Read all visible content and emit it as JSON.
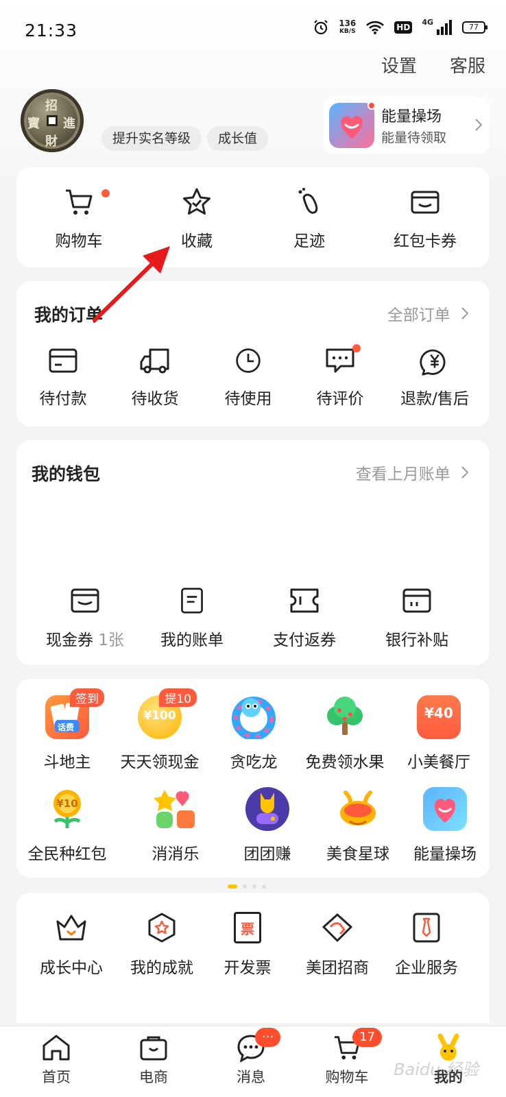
{
  "status_bar": {
    "time": "21:33",
    "net_speed": "136",
    "net_unit": "KB/S",
    "hd": "HD",
    "network": "4G",
    "battery": "77"
  },
  "top_links": {
    "settings": "设置",
    "service": "客服"
  },
  "profile": {
    "avatar_chars": [
      "招",
      "進",
      "財",
      "寶"
    ],
    "pill_realname": "提升实名等级",
    "pill_growth": "成长值"
  },
  "energy_card": {
    "title": "能量操场",
    "subtitle": "能量待领取"
  },
  "quick": [
    {
      "label": "购物车",
      "icon": "cart-icon"
    },
    {
      "label": "收藏",
      "icon": "star-icon"
    },
    {
      "label": "足迹",
      "icon": "footprint-icon"
    },
    {
      "label": "红包卡券",
      "icon": "wallet-card-icon"
    }
  ],
  "orders": {
    "title": "我的订单",
    "all_link": "全部订单",
    "items": [
      {
        "label": "待付款",
        "icon": "card-icon"
      },
      {
        "label": "待收货",
        "icon": "truck-icon"
      },
      {
        "label": "待使用",
        "icon": "clock-icon"
      },
      {
        "label": "待评价",
        "icon": "comment-icon"
      },
      {
        "label": "退款/售后",
        "icon": "yen-refund-icon"
      }
    ]
  },
  "wallet": {
    "title": "我的钱包",
    "link": "查看上月账单",
    "items": [
      {
        "label": "现金券",
        "sub": "1张",
        "icon": "coupon-wallet-icon"
      },
      {
        "label": "我的账单",
        "icon": "bill-icon"
      },
      {
        "label": "支付返券",
        "icon": "ticket-icon"
      },
      {
        "label": "银行补贴",
        "icon": "bank-card-icon"
      }
    ]
  },
  "games": {
    "row1": [
      {
        "label": "斗地主",
        "badge": "签到",
        "icon": "doudizhu-icon",
        "icon_text": "话费"
      },
      {
        "label": "天天领现金",
        "badge": "提10",
        "icon": "cash-coin-icon",
        "icon_text": "¥100"
      },
      {
        "label": "贪吃龙",
        "icon": "snake-icon"
      },
      {
        "label": "免费领水果",
        "icon": "fruit-tree-icon"
      },
      {
        "label": "小美餐厅",
        "icon": "restaurant-icon",
        "icon_text": "¥40"
      }
    ],
    "row2": [
      {
        "label": "全民种红包",
        "icon": "flower-icon",
        "icon_text": "¥10"
      },
      {
        "label": "消消乐",
        "icon": "match-icon"
      },
      {
        "label": "团团赚",
        "icon": "tuantuan-icon"
      },
      {
        "label": "美食星球",
        "icon": "food-planet-icon"
      },
      {
        "label": "能量操场",
        "icon": "energy-heart-icon"
      }
    ]
  },
  "services": [
    {
      "label": "成长中心",
      "icon": "crown-icon"
    },
    {
      "label": "我的成就",
      "icon": "badge-icon"
    },
    {
      "label": "开发票",
      "icon": "invoice-icon",
      "icon_text": "票"
    },
    {
      "label": "美团招商",
      "icon": "handshake-icon"
    },
    {
      "label": "企业服务",
      "icon": "tie-icon"
    }
  ],
  "tabbar": [
    {
      "label": "首页",
      "icon": "home-icon"
    },
    {
      "label": "电商",
      "icon": "shop-bag-icon"
    },
    {
      "label": "消息",
      "icon": "message-icon",
      "badge": "···"
    },
    {
      "label": "购物车",
      "icon": "cart-icon",
      "badge": "17"
    },
    {
      "label": "我的",
      "icon": "mine-icon"
    }
  ],
  "watermark": "Baidu 经验",
  "colors": {
    "accent": "#ffc300",
    "badge_red": "#ff5a3c",
    "annotation_arrow": "#e8191b"
  }
}
